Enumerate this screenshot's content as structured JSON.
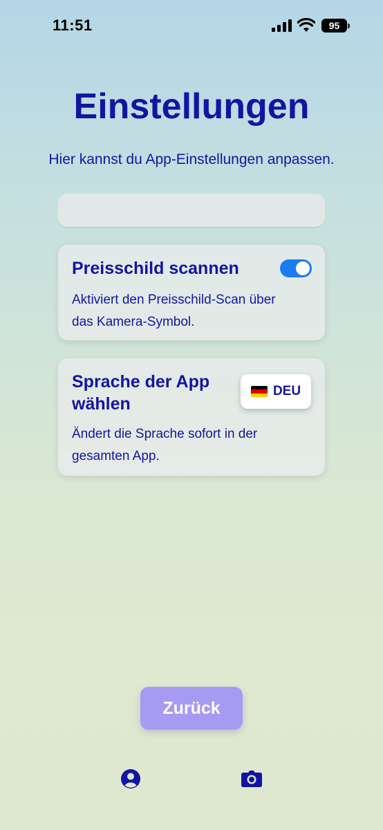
{
  "status_bar": {
    "time": "11:51",
    "battery": "95",
    "icons": [
      "signal-icon",
      "wifi-icon",
      "battery-icon"
    ]
  },
  "header": {
    "title": "Einstellungen",
    "subtitle": "Hier kannst du App-Einstellungen anpassen."
  },
  "settings": {
    "price_tag_scan": {
      "title": "Preisschild scannen",
      "description": "Aktiviert den Preisschild-Scan über das Kamera-Symbol.",
      "enabled": true
    },
    "language": {
      "title": "Sprache der App wählen",
      "description": "Ändert die Sprache sofort in der gesamten App.",
      "selected_code": "DEU",
      "flag_icon": "german-flag-icon"
    }
  },
  "back_button": {
    "label": "Zurück"
  },
  "tab_bar": {
    "items": [
      {
        "icon": "profile-icon"
      },
      {
        "icon": "camera-icon"
      }
    ]
  },
  "colors": {
    "primary_text": "#1414a0",
    "toggle_on": "#1a7cf0",
    "back_button": "#a79af2"
  }
}
